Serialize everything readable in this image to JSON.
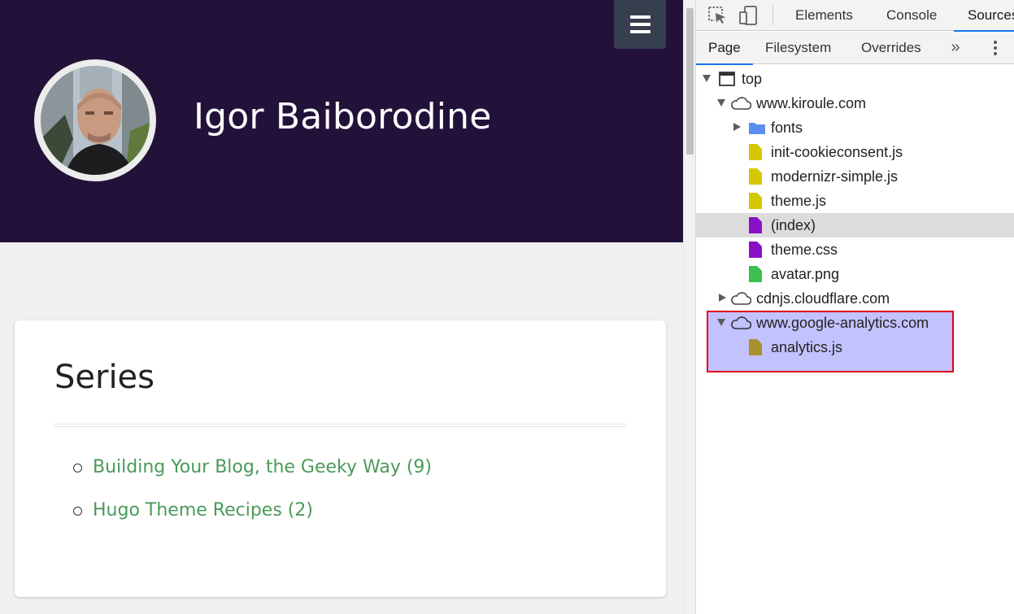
{
  "site": {
    "title": "Igor Baiborodine",
    "menu_icon": "hamburger-icon",
    "series": {
      "heading": "Series",
      "items": [
        {
          "label": "Building Your Blog, the Geeky Way (9)"
        },
        {
          "label": "Hugo Theme Recipes (2)"
        }
      ]
    },
    "colors": {
      "header_bg": "#22123a",
      "link": "#4a9a5a"
    }
  },
  "devtools": {
    "toolbar": {
      "inspect_icon": "inspect-element-icon",
      "device_icon": "device-toolbar-icon",
      "tabs": [
        "Elements",
        "Console",
        "Sources"
      ]
    },
    "subtabs": [
      "Page",
      "Filesystem",
      "Overrides"
    ],
    "more_tabs_icon": "chevron-double-right-icon",
    "menu_icon": "kebab-menu-icon",
    "tree": {
      "top": "top",
      "origin_kiroule": "www.kiroule.com",
      "folder_fonts": "fonts",
      "file_init_cookie": "init-cookieconsent.js",
      "file_modernizr": "modernizr-simple.js",
      "file_theme_js": "theme.js",
      "file_index": "(index)",
      "file_theme_css": "theme.css",
      "file_avatar": "avatar.png",
      "origin_cdnjs": "cdnjs.cloudflare.com",
      "origin_ga": "www.google-analytics.com",
      "file_analytics": "analytics.js"
    },
    "colors": {
      "js_file": "#d4c800",
      "doc_file": "#8a10c8",
      "image_file": "#3cc050",
      "folder": "#5a8ff0",
      "analytics_file": "#a89030",
      "highlight_fill": "#c2c2ff",
      "highlight_border": "#e0001b",
      "active_tab": "#1a73e8"
    }
  }
}
